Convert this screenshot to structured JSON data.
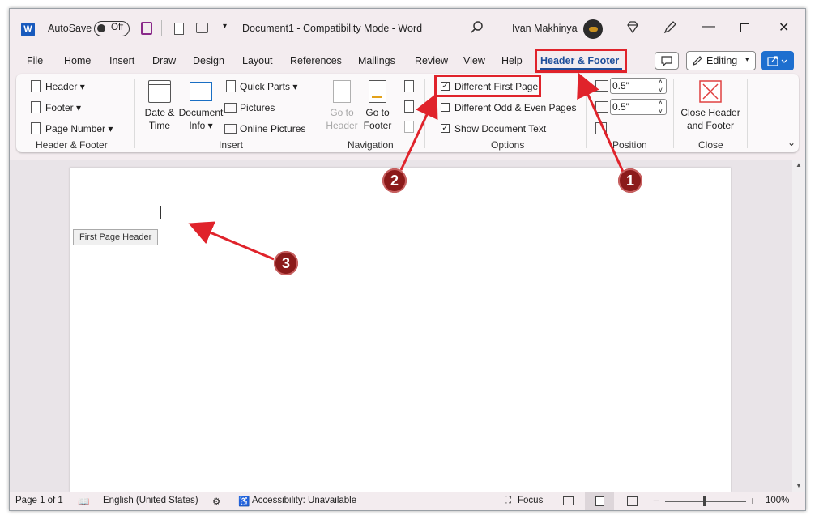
{
  "titlebar": {
    "autosave_label": "AutoSave",
    "autosave_state": "Off",
    "doc_title": "Document1  -  Compatibility Mode  -  Word",
    "user_name": "Ivan Makhinya",
    "app_letter": "W"
  },
  "tabs": [
    "File",
    "Home",
    "Insert",
    "Draw",
    "Design",
    "Layout",
    "References",
    "Mailings",
    "Review",
    "View",
    "Help",
    "Header & Footer"
  ],
  "active_tab": "Header & Footer",
  "editing_label": "Editing",
  "ribbon": {
    "header_footer_group": {
      "header": "Header",
      "footer": "Footer",
      "page_number": "Page Number",
      "label": "Header & Footer"
    },
    "insert_group": {
      "date_time": [
        "Date &",
        "Time"
      ],
      "document_info": [
        "Document",
        "Info"
      ],
      "quick_parts": "Quick Parts",
      "pictures": "Pictures",
      "online_pictures": "Online Pictures",
      "label": "Insert"
    },
    "navigation_group": {
      "go_to_header": [
        "Go to",
        "Header"
      ],
      "go_to_footer": [
        "Go to",
        "Footer"
      ],
      "label": "Navigation"
    },
    "options_group": {
      "different_first_page": "Different First Page",
      "different_odd_even": "Different Odd & Even Pages",
      "show_document_text": "Show Document Text",
      "different_first_page_checked": true,
      "different_odd_even_checked": false,
      "show_document_text_checked": true,
      "label": "Options"
    },
    "position_group": {
      "header_from_top": "0.5\"",
      "footer_from_bottom": "0.5\"",
      "label": "Position"
    },
    "close_group": {
      "close_button": [
        "Close Header",
        "and Footer"
      ],
      "label": "Close"
    }
  },
  "document": {
    "header_tag": "First Page Header"
  },
  "statusbar": {
    "page": "Page 1 of 1",
    "language": "English (United States)",
    "accessibility": "Accessibility: Unavailable",
    "focus": "Focus",
    "zoom": "100%"
  },
  "annotations": [
    "1",
    "2",
    "3"
  ],
  "colors": {
    "annotation_red": "#e0232b",
    "badge": "#8b1a1a",
    "accent": "#1e4e9a",
    "word_blue": "#185abd"
  }
}
